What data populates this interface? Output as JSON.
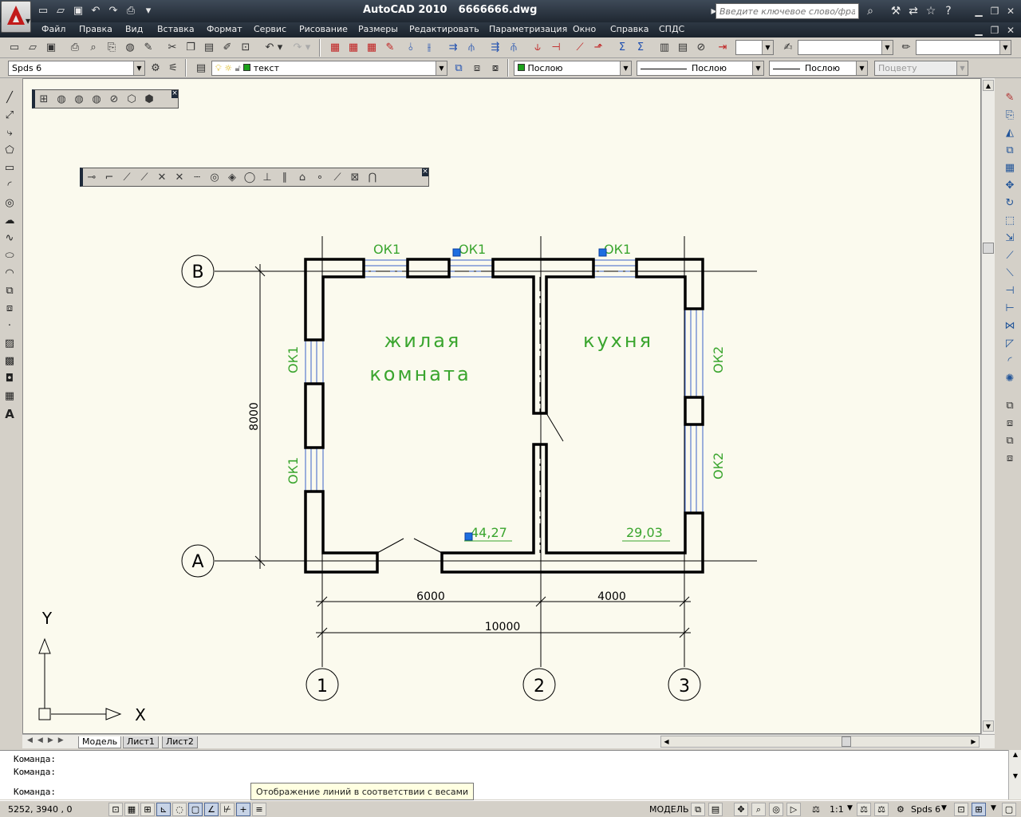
{
  "app": {
    "name": "AutoCAD 2010",
    "file": "6666666.dwg"
  },
  "search": {
    "placeholder": "Введите ключевое слово/фразу"
  },
  "menu": [
    "Файл",
    "Правка",
    "Вид",
    "Вставка",
    "Формат",
    "Сервис",
    "Рисование",
    "Размеры",
    "Редактировать",
    "Параметризация",
    "Окно",
    "Справка",
    "СПДС"
  ],
  "toolbar3": {
    "style_combo": "Spds 6",
    "layer_combo": "текст",
    "color_combo": "Послою",
    "linetype_combo": "Послою",
    "lineweight_combo": "Послою",
    "plotstyle_combo": "Поцвету"
  },
  "drawing": {
    "axis_rows": [
      "B",
      "A"
    ],
    "axis_cols": [
      "1",
      "2",
      "3"
    ],
    "room1_line1": "жилая",
    "room1_line2": "комната",
    "room2": "кухня",
    "win_top_1": "ОК1",
    "win_top_2": "ОК1",
    "win_top_3": "ОК1",
    "win_left_1": "ОК1",
    "win_left_2": "ОК1",
    "win_right_1": "ОК2",
    "win_right_2": "ОК2",
    "area_1": "44,27",
    "area_2": "29,03",
    "dim_height": "8000",
    "dim_1": "6000",
    "dim_2": "4000",
    "dim_total": "10000",
    "ucs_x": "X",
    "ucs_y": "Y"
  },
  "tabs": [
    "Модель",
    "Лист1",
    "Лист2"
  ],
  "command": {
    "line1": "Команда:",
    "line2": "Команда:",
    "prompt": "Команда:"
  },
  "tooltip": "Отображение линий в соответствии с весами",
  "status": {
    "coords": "5252, 3940 , 0",
    "model": "МОДЕЛЬ",
    "scale": "1:1",
    "workspace": "Spds 6"
  },
  "colors": {
    "green_text": "#3aa52e",
    "window_blue": "#3b62c8",
    "grip_blue": "#1d6ee0",
    "canvas": "#fbfaee"
  }
}
